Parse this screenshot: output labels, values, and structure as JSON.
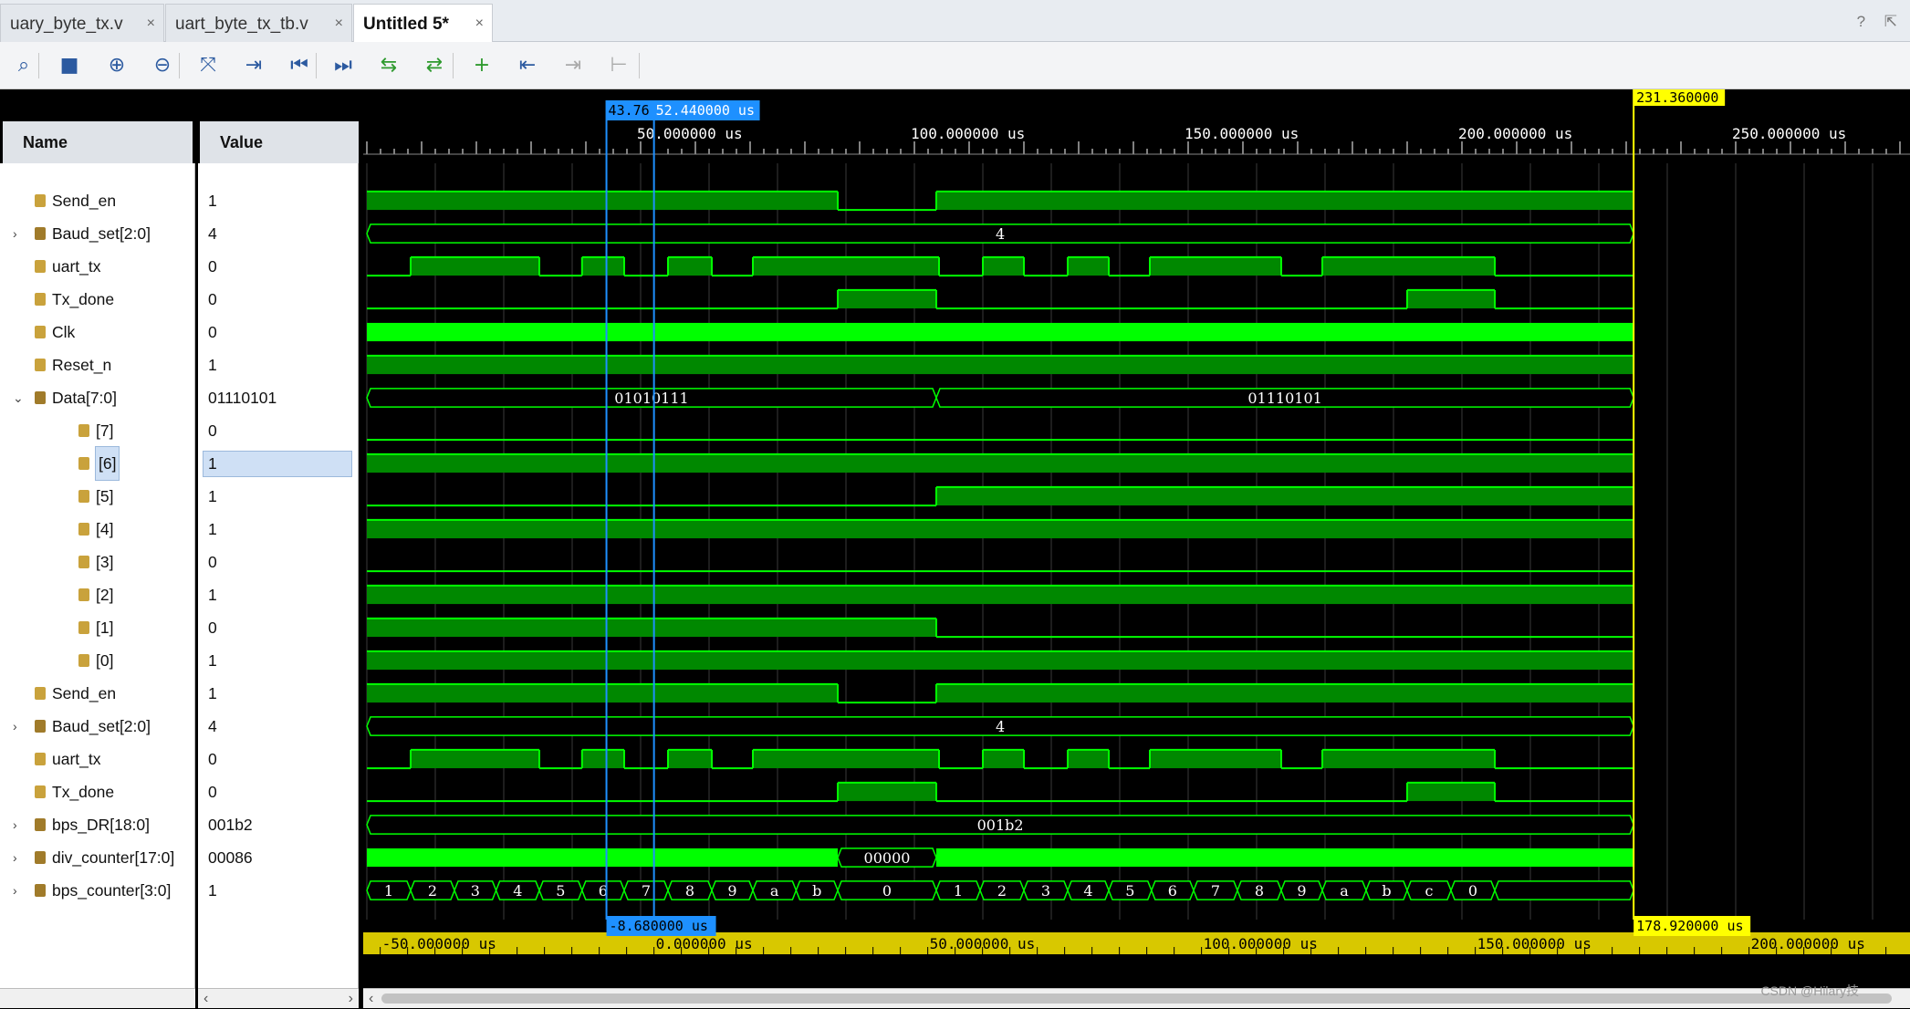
{
  "tabs": [
    {
      "label": "uary_byte_tx.v",
      "close": "×"
    },
    {
      "label": "uart_byte_tx_tb.v",
      "close": "×"
    },
    {
      "label": "Untitled 5*",
      "close": "×"
    }
  ],
  "tabbar_right": "? ⇱",
  "toolbar": {
    "buttons": [
      {
        "name": "search-icon",
        "glyph": "⌕"
      },
      {
        "name": "save-icon",
        "glyph": "■"
      },
      {
        "name": "zoom-in-icon",
        "glyph": "⊕"
      },
      {
        "name": "zoom-out-icon",
        "glyph": "⊖"
      },
      {
        "name": "zoom-fit-icon",
        "glyph": "⤧"
      },
      {
        "name": "go-to-cursor-icon",
        "glyph": "⇥"
      },
      {
        "name": "go-to-start-icon",
        "glyph": "⏮"
      },
      {
        "name": "go-to-end-icon",
        "glyph": "⏭"
      },
      {
        "name": "previous-transition-icon",
        "glyph": "⇆"
      },
      {
        "name": "next-transition-icon",
        "glyph": "⇄"
      },
      {
        "name": "add-marker-icon",
        "glyph": "+"
      },
      {
        "name": "previous-marker-icon",
        "glyph": "⇤"
      },
      {
        "name": "next-marker-icon",
        "glyph": "⇥"
      },
      {
        "name": "swap-cursors-icon",
        "glyph": "⊢"
      }
    ]
  },
  "header": {
    "name": "Name",
    "value": "Value"
  },
  "signals": [
    {
      "name": "Send_en",
      "value": "1",
      "type": "bit",
      "expand": "",
      "indent": 0,
      "wave": "bit",
      "pattern": [
        [
          0,
          1
        ],
        [
          86,
          0
        ],
        [
          104,
          1
        ]
      ]
    },
    {
      "name": "Baud_set[2:0]",
      "value": "4",
      "type": "bus",
      "expand": "›",
      "indent": 0,
      "wave": "bus",
      "segments": [
        [
          0,
          "4"
        ]
      ]
    },
    {
      "name": "uart_tx",
      "value": "0",
      "type": "bit",
      "expand": "",
      "indent": 0,
      "wave": "bit",
      "pattern": [
        [
          0,
          0
        ],
        [
          8,
          1
        ],
        [
          31.5,
          0
        ],
        [
          39.3,
          1
        ],
        [
          47,
          0
        ],
        [
          55,
          1
        ],
        [
          63,
          0
        ],
        [
          70.5,
          1
        ],
        [
          104.5,
          0
        ],
        [
          112.5,
          1
        ],
        [
          120,
          0
        ],
        [
          128,
          1
        ],
        [
          135.5,
          0
        ],
        [
          143,
          1
        ],
        [
          167,
          0
        ],
        [
          174.5,
          1
        ],
        [
          206,
          0
        ]
      ]
    },
    {
      "name": "Tx_done",
      "value": "0",
      "type": "bit",
      "expand": "",
      "indent": 0,
      "wave": "bit",
      "pattern": [
        [
          0,
          0
        ],
        [
          86,
          1
        ],
        [
          104,
          0
        ],
        [
          190,
          1
        ],
        [
          206,
          0
        ]
      ]
    },
    {
      "name": "Clk",
      "value": "0",
      "type": "bit",
      "expand": "",
      "indent": 0,
      "wave": "clk"
    },
    {
      "name": "Reset_n",
      "value": "1",
      "type": "bit",
      "expand": "",
      "indent": 0,
      "wave": "bit",
      "pattern": [
        [
          0,
          1
        ]
      ]
    },
    {
      "name": "Data[7:0]",
      "value": "01110101",
      "type": "bus",
      "expand": "⌄",
      "indent": 0,
      "wave": "bus",
      "segments": [
        [
          0,
          "01010111"
        ],
        [
          104,
          "01110101"
        ]
      ]
    },
    {
      "name": "[7]",
      "value": "0",
      "type": "bit",
      "expand": "",
      "indent": 1,
      "wave": "bit",
      "pattern": [
        [
          0,
          0
        ]
      ]
    },
    {
      "name": "[6]",
      "value": "1",
      "type": "bit",
      "expand": "",
      "indent": 1,
      "wave": "bit",
      "pattern": [
        [
          0,
          1
        ]
      ],
      "selected": true
    },
    {
      "name": "[5]",
      "value": "1",
      "type": "bit",
      "expand": "",
      "indent": 1,
      "wave": "bit",
      "pattern": [
        [
          0,
          0
        ],
        [
          104,
          1
        ]
      ]
    },
    {
      "name": "[4]",
      "value": "1",
      "type": "bit",
      "expand": "",
      "indent": 1,
      "wave": "bit",
      "pattern": [
        [
          0,
          1
        ]
      ]
    },
    {
      "name": "[3]",
      "value": "0",
      "type": "bit",
      "expand": "",
      "indent": 1,
      "wave": "bit",
      "pattern": [
        [
          0,
          0
        ]
      ]
    },
    {
      "name": "[2]",
      "value": "1",
      "type": "bit",
      "expand": "",
      "indent": 1,
      "wave": "bit",
      "pattern": [
        [
          0,
          1
        ]
      ]
    },
    {
      "name": "[1]",
      "value": "0",
      "type": "bit",
      "expand": "",
      "indent": 1,
      "wave": "bit",
      "pattern": [
        [
          0,
          1
        ],
        [
          104,
          0
        ]
      ]
    },
    {
      "name": "[0]",
      "value": "1",
      "type": "bit",
      "expand": "",
      "indent": 1,
      "wave": "bit",
      "pattern": [
        [
          0,
          1
        ]
      ]
    },
    {
      "name": "Send_en",
      "value": "1",
      "type": "bit",
      "expand": "",
      "indent": 0,
      "wave": "bit",
      "pattern": [
        [
          0,
          1
        ],
        [
          86,
          0
        ],
        [
          104,
          1
        ]
      ]
    },
    {
      "name": "Baud_set[2:0]",
      "value": "4",
      "type": "bus",
      "expand": "›",
      "indent": 0,
      "wave": "bus",
      "segments": [
        [
          0,
          "4"
        ]
      ]
    },
    {
      "name": "uart_tx",
      "value": "0",
      "type": "bit",
      "expand": "",
      "indent": 0,
      "wave": "bit",
      "pattern": [
        [
          0,
          0
        ],
        [
          8,
          1
        ],
        [
          31.5,
          0
        ],
        [
          39.3,
          1
        ],
        [
          47,
          0
        ],
        [
          55,
          1
        ],
        [
          63,
          0
        ],
        [
          70.5,
          1
        ],
        [
          104.5,
          0
        ],
        [
          112.5,
          1
        ],
        [
          120,
          0
        ],
        [
          128,
          1
        ],
        [
          135.5,
          0
        ],
        [
          143,
          1
        ],
        [
          167,
          0
        ],
        [
          174.5,
          1
        ],
        [
          206,
          0
        ]
      ]
    },
    {
      "name": "Tx_done",
      "value": "0",
      "type": "bit",
      "expand": "",
      "indent": 0,
      "wave": "bit",
      "pattern": [
        [
          0,
          0
        ],
        [
          86,
          1
        ],
        [
          104,
          0
        ],
        [
          190,
          1
        ],
        [
          206,
          0
        ]
      ]
    },
    {
      "name": "bps_DR[18:0]",
      "value": "001b2",
      "type": "bus",
      "expand": "›",
      "indent": 0,
      "wave": "bus",
      "segments": [
        [
          0,
          "001b2"
        ]
      ]
    },
    {
      "name": "div_counter[17:0]",
      "value": "00086",
      "type": "bus",
      "expand": "›",
      "indent": 0,
      "wave": "dense",
      "segments": [
        [
          0,
          "dense"
        ],
        [
          86,
          "00000"
        ],
        [
          104,
          "dense"
        ]
      ]
    },
    {
      "name": "bps_counter[3:0]",
      "value": "1",
      "type": "bus",
      "expand": "›",
      "indent": 0,
      "wave": "bus",
      "segments": [
        [
          0,
          "1"
        ],
        [
          8,
          "2"
        ],
        [
          16,
          "3"
        ],
        [
          23.6,
          "4"
        ],
        [
          31.5,
          "5"
        ],
        [
          39.3,
          "6"
        ],
        [
          47,
          "7"
        ],
        [
          55,
          "8"
        ],
        [
          63,
          "9"
        ],
        [
          70.5,
          "a"
        ],
        [
          78.4,
          "b"
        ],
        [
          86,
          "0"
        ],
        [
          104,
          "1"
        ],
        [
          112,
          "2"
        ],
        [
          120,
          "3"
        ],
        [
          128,
          "4"
        ],
        [
          135.5,
          "5"
        ],
        [
          143.3,
          "6"
        ],
        [
          151,
          "7"
        ],
        [
          159,
          "8"
        ],
        [
          167,
          "9"
        ],
        [
          174.5,
          "a"
        ],
        [
          182.5,
          "b"
        ],
        [
          190,
          "c"
        ],
        [
          198,
          "0"
        ],
        [
          206,
          ""
        ]
      ]
    }
  ],
  "time_axis": {
    "unit": "us",
    "labels": [
      "50.000000 us",
      "100.000000 us",
      "150.000000 us",
      "200.000000 us",
      "250.000000 us"
    ],
    "label_values": [
      50,
      100,
      150,
      200,
      250
    ],
    "sim_end": 231.36
  },
  "cursors": {
    "yellow": {
      "time": 231.36,
      "label": "231.360000 us",
      "color": "#ffff00"
    },
    "blue_a": {
      "time": 43.76,
      "label": "43.76",
      "color": "#1e90ff"
    },
    "blue_b": {
      "time": 52.44,
      "label": "52.440000 us",
      "color": "#1e90ff"
    }
  },
  "delta_axis": {
    "labels": [
      "-50.000000 us",
      "0.000000 us",
      "50.000000 us",
      "100.000000 us",
      "150.000000 us",
      "200.000000 us"
    ],
    "label_values": [
      -50,
      0,
      50,
      100,
      150,
      200
    ],
    "delta_blue": "-8.680000 us",
    "delta_yellow": "178.920000 us"
  },
  "watermark": "CSDN @Hilary技",
  "colors": {
    "wave": "#00ff00",
    "wave_fill": "#008800",
    "axis_bar": "#d8c800",
    "cursor_yellow": "#ffff00",
    "cursor_blue": "#1e90ff"
  }
}
